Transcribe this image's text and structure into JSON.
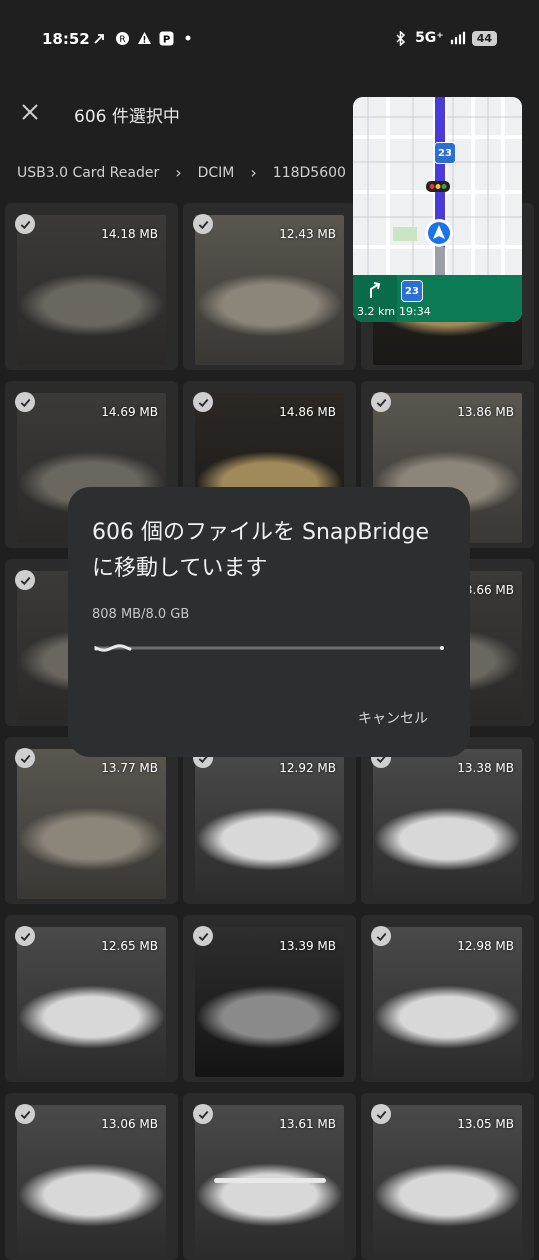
{
  "status_bar": {
    "time": "18:52",
    "network": "5G⁺",
    "battery": "44"
  },
  "header": {
    "title": "606 件選択中"
  },
  "breadcrumb": {
    "items": [
      "USB3.0 Card Reader",
      "DCIM",
      "118D5600"
    ]
  },
  "photos": [
    {
      "size": "14.18 MB",
      "selected": true,
      "palette": "dark-sedan"
    },
    {
      "size": "12.43 MB",
      "selected": true,
      "palette": "grey-front"
    },
    {
      "size": "",
      "selected": true,
      "palette": "interior-gold"
    },
    {
      "size": "14.69 MB",
      "selected": true,
      "palette": "dark-sedan"
    },
    {
      "size": "14.86 MB",
      "selected": true,
      "palette": "interior-gold"
    },
    {
      "size": "13.86 MB",
      "selected": true,
      "palette": "grey-front"
    },
    {
      "size": "",
      "selected": true,
      "palette": "dark-sedan"
    },
    {
      "size": "",
      "selected": false,
      "palette": "grey-front"
    },
    {
      "size": "13.66 MB",
      "selected": false,
      "palette": "dark-sedan"
    },
    {
      "size": "13.77 MB",
      "selected": true,
      "palette": "grey-front"
    },
    {
      "size": "12.92 MB",
      "selected": true,
      "palette": "white-car"
    },
    {
      "size": "13.38 MB",
      "selected": true,
      "palette": "white-car"
    },
    {
      "size": "12.65 MB",
      "selected": true,
      "palette": "white-car"
    },
    {
      "size": "13.39 MB",
      "selected": true,
      "palette": "interior-dark"
    },
    {
      "size": "12.98 MB",
      "selected": true,
      "palette": "white-car"
    },
    {
      "size": "13.06 MB",
      "selected": true,
      "palette": "white-car"
    },
    {
      "size": "13.61 MB",
      "selected": true,
      "palette": "white-car"
    },
    {
      "size": "13.05 MB",
      "selected": true,
      "palette": "white-car"
    }
  ],
  "map_overlay": {
    "route": "23",
    "distance": "3.2 km",
    "eta": "19:34"
  },
  "dialog": {
    "title": "606 個のファイルを SnapBridge に移動しています",
    "progress_text": "808 MB/8.0 GB",
    "progress_fraction": 0.101,
    "cancel_label": "キャンセル"
  },
  "colors": {
    "background": "#1f1f1f",
    "tile": "#2b2b2b",
    "dialog": "#2d2e2f",
    "map_route": "#4a3ad8",
    "map_banner": "#0b7a55"
  }
}
